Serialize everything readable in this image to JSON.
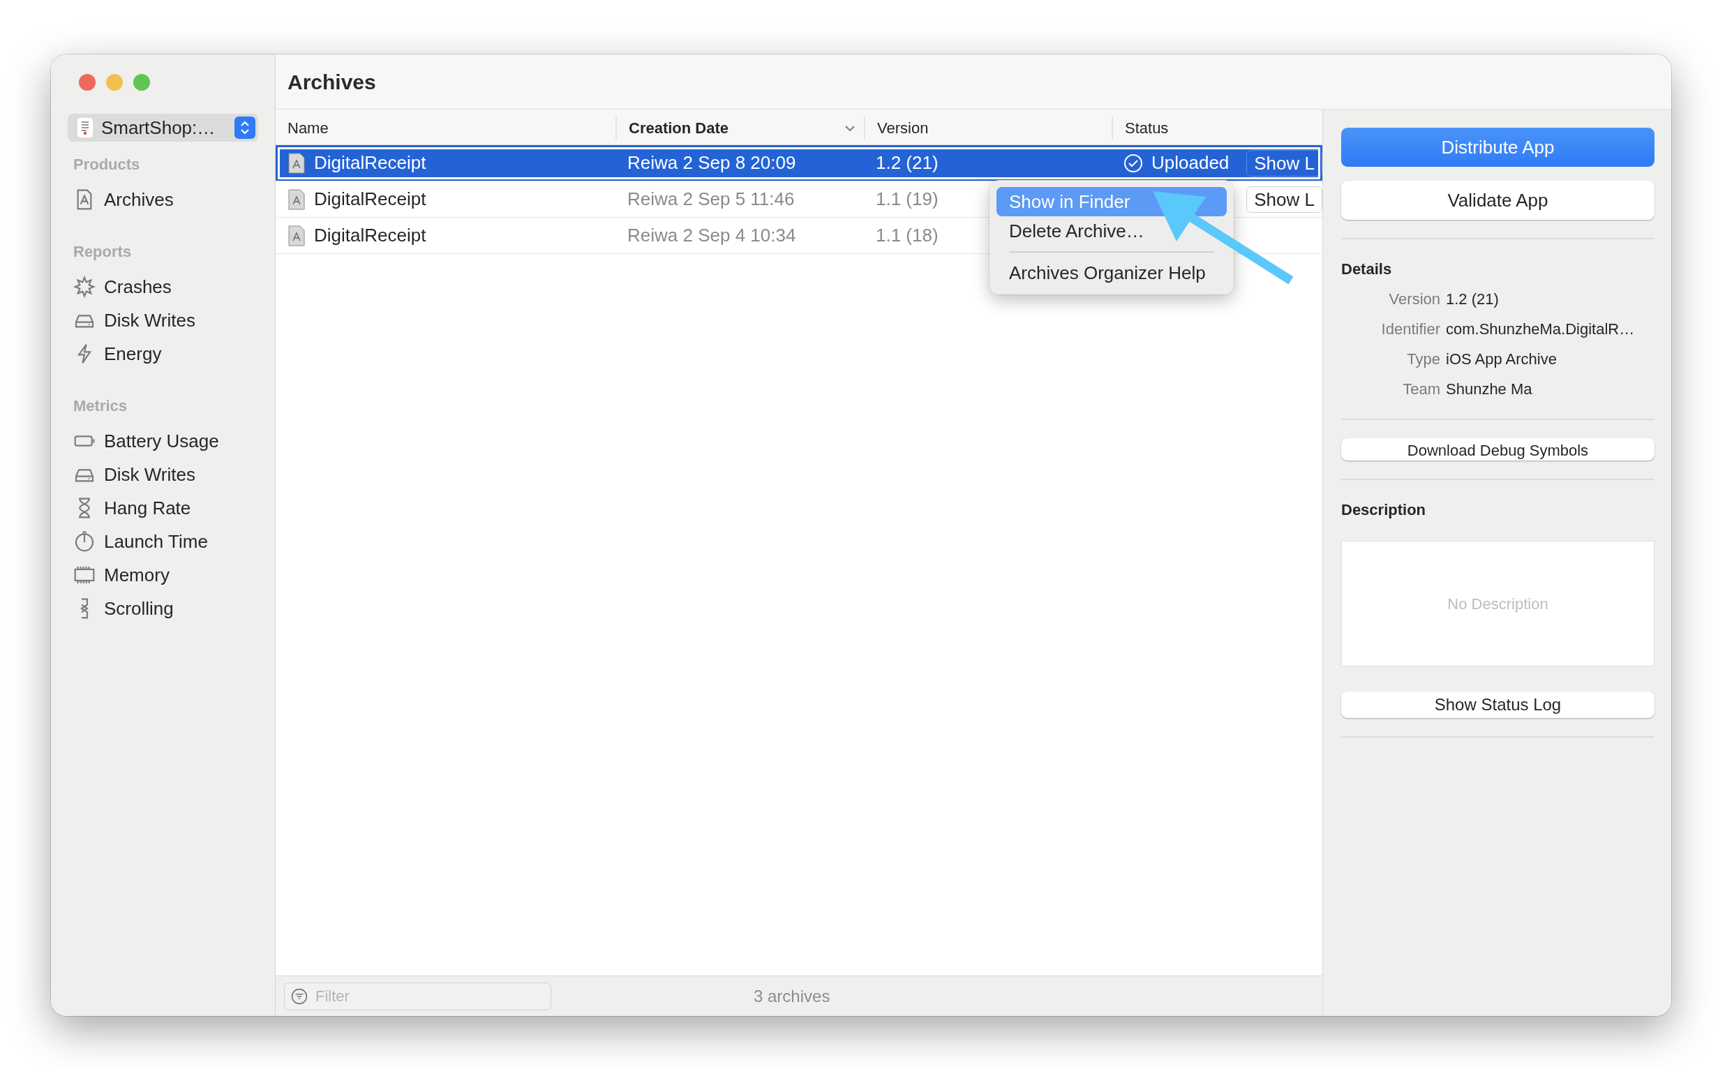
{
  "window": {
    "title": "Archives"
  },
  "scheme_selector": {
    "label": "SmartShop:…"
  },
  "sidebar": {
    "sections": [
      {
        "title": "Products",
        "items": [
          {
            "label": "Archives"
          }
        ]
      },
      {
        "title": "Reports",
        "items": [
          {
            "label": "Crashes"
          },
          {
            "label": "Disk Writes"
          },
          {
            "label": "Energy"
          }
        ]
      },
      {
        "title": "Metrics",
        "items": [
          {
            "label": "Battery Usage"
          },
          {
            "label": "Disk Writes"
          },
          {
            "label": "Hang Rate"
          },
          {
            "label": "Launch Time"
          },
          {
            "label": "Memory"
          },
          {
            "label": "Scrolling"
          }
        ]
      }
    ]
  },
  "table": {
    "columns": [
      {
        "label": "Name",
        "sorted": false
      },
      {
        "label": "Creation Date",
        "sorted": true
      },
      {
        "label": "Version",
        "sorted": false
      },
      {
        "label": "Status",
        "sorted": false
      }
    ],
    "rows": [
      {
        "name": "DigitalReceipt",
        "date": "Reiwa 2 Sep 8 20:09",
        "version": "1.2 (21)",
        "status": "Uploaded",
        "action": "Show L",
        "selected": true
      },
      {
        "name": "DigitalReceipt",
        "date": "Reiwa 2 Sep 5 11:46",
        "version": "1.1 (19)",
        "action": "Show L",
        "selected": false
      },
      {
        "name": "DigitalReceipt",
        "date": "Reiwa 2 Sep 4 10:34",
        "version": "1.1 (18)",
        "selected": false
      }
    ]
  },
  "context_menu": {
    "groups": [
      [
        {
          "label": "Show in Finder",
          "selected": true
        },
        {
          "label": "Delete Archive…",
          "selected": false
        }
      ],
      [
        {
          "label": "Archives Organizer Help",
          "selected": false
        }
      ]
    ]
  },
  "footer": {
    "filter": {
      "placeholder": "Filter"
    },
    "count": "3 archives"
  },
  "inspector": {
    "primary_button": "Distribute App",
    "secondary_button": "Validate App",
    "details": {
      "title": "Details",
      "fields": [
        {
          "label": "Version",
          "value": "1.2 (21)"
        },
        {
          "label": "Identifier",
          "value": "com.ShunzheMa.DigitalR…"
        },
        {
          "label": "Type",
          "value": "iOS App Archive"
        },
        {
          "label": "Team",
          "value": "Shunzhe Ma"
        }
      ]
    },
    "debug_button": "Download Debug Symbols",
    "description": {
      "title": "Description",
      "placeholder": "No Description"
    },
    "log_button": "Show Status Log"
  }
}
